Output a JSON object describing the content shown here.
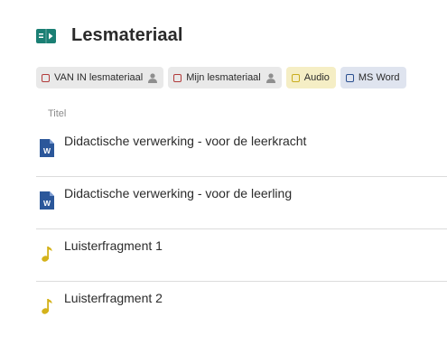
{
  "header": {
    "title": "Lesmateriaal",
    "icon": "book-video-icon",
    "accent": "#1a7f74"
  },
  "filters": [
    {
      "label": "VAN IN lesmateriaal",
      "style": "grey",
      "has_person_icon": true
    },
    {
      "label": "Mijn lesmateriaal",
      "style": "grey",
      "has_person_icon": true
    },
    {
      "label": "Audio",
      "style": "yellow",
      "has_person_icon": false
    },
    {
      "label": "MS Word",
      "style": "blue",
      "has_person_icon": false
    }
  ],
  "table": {
    "column_header": "Titel",
    "rows": [
      {
        "title": "Didactische verwerking - voor de leerkracht",
        "type": "word-document-icon"
      },
      {
        "title": "Didactische verwerking - voor de leerling",
        "type": "word-document-icon"
      },
      {
        "title": "Luisterfragment 1",
        "type": "music-note-icon"
      },
      {
        "title": "Luisterfragment 2",
        "type": "music-note-icon"
      }
    ]
  },
  "colors": {
    "word_blue": "#2b579a",
    "audio_yellow": "#d4b21a",
    "person_grey": "#8e8e8e"
  }
}
